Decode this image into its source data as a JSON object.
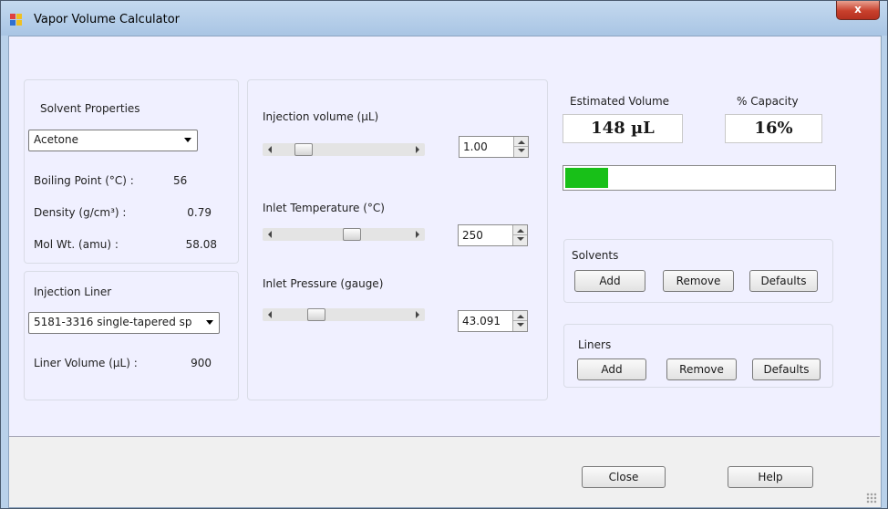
{
  "window": {
    "title": "Vapor Volume Calculator",
    "close_label": "x"
  },
  "solvent": {
    "heading": "Solvent Properties",
    "selected": "Acetone",
    "props": [
      {
        "label": "Boiling Point (°C) :",
        "value": "56"
      },
      {
        "label": "Density (g/cm³) :",
        "value": "0.79"
      },
      {
        "label": "Mol Wt. (amu) :",
        "value": "58.08"
      }
    ]
  },
  "liner": {
    "heading": "Injection Liner",
    "selected": "5181-3316 single-tapered sp",
    "volume_label": "Liner Volume (µL) :",
    "volume_value": "900"
  },
  "params": [
    {
      "label": "Injection volume (µL)",
      "value": "1.00",
      "slider_level": 0.15
    },
    {
      "label": "Inlet Temperature (°C)",
      "value": "250",
      "slider_level": 0.58
    },
    {
      "label": "Inlet Pressure (gauge)",
      "value": "43.091",
      "slider_level": 0.27
    }
  ],
  "results": {
    "volume_label": "Estimated Volume",
    "volume_value": "148 µL",
    "capacity_label": "% Capacity",
    "capacity_value": "16%",
    "capacity_fraction": 0.16,
    "bar_color": "#18c018"
  },
  "solvents_group": {
    "title": "Solvents",
    "add": "Add",
    "remove": "Remove",
    "defaults": "Defaults"
  },
  "liners_group": {
    "title": "Liners",
    "add": "Add",
    "remove": "Remove",
    "defaults": "Defaults"
  },
  "footer": {
    "close": "Close",
    "help": "Help"
  }
}
